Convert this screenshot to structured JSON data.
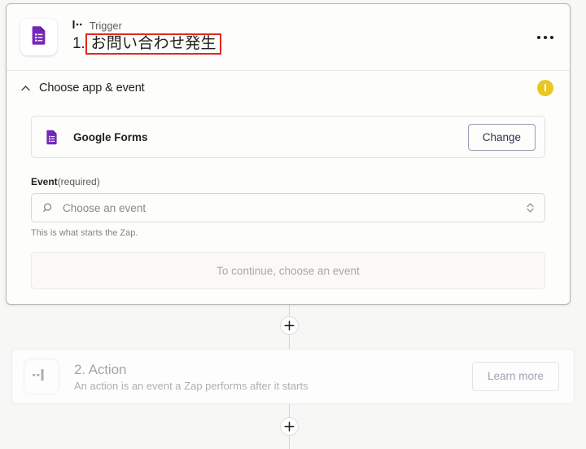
{
  "colors": {
    "accent_purple": "#7627BB",
    "annotation_red": "#E02A1C",
    "warning_yellow": "#E8C820",
    "page_background": "#F7F7F6",
    "card_background": "#FDFDFC",
    "button_navy": "#31314F"
  },
  "trigger": {
    "app_icon_name": "google-forms-icon",
    "kicker_icon_name": "trigger-bolt-icon",
    "kicker_label": "Trigger",
    "step_number": "1.",
    "step_title": "お問い合わせ発生",
    "menu_icon_name": "more-options-icon",
    "section": {
      "collapse_icon_name": "chevron-up-icon",
      "title": "Choose app & event",
      "status_icon_name": "warning-icon"
    },
    "app_row": {
      "icon_name": "google-forms-icon",
      "name": "Google Forms",
      "change_label": "Change"
    },
    "event_field": {
      "label": "Event",
      "required_text": "(required)",
      "search_icon_name": "search-icon",
      "placeholder": "Choose an event",
      "stepper_icon_name": "chevron-up-down-icon",
      "help_text": "This is what starts the Zap."
    },
    "continue_notice": "To continue, choose an event"
  },
  "connectors": {
    "add_step_icon_name": "plus-icon"
  },
  "action": {
    "icon_name": "action-step-icon",
    "title": "2. Action",
    "subtitle": "An action is an event a Zap performs after it starts",
    "learn_more_label": "Learn more"
  }
}
